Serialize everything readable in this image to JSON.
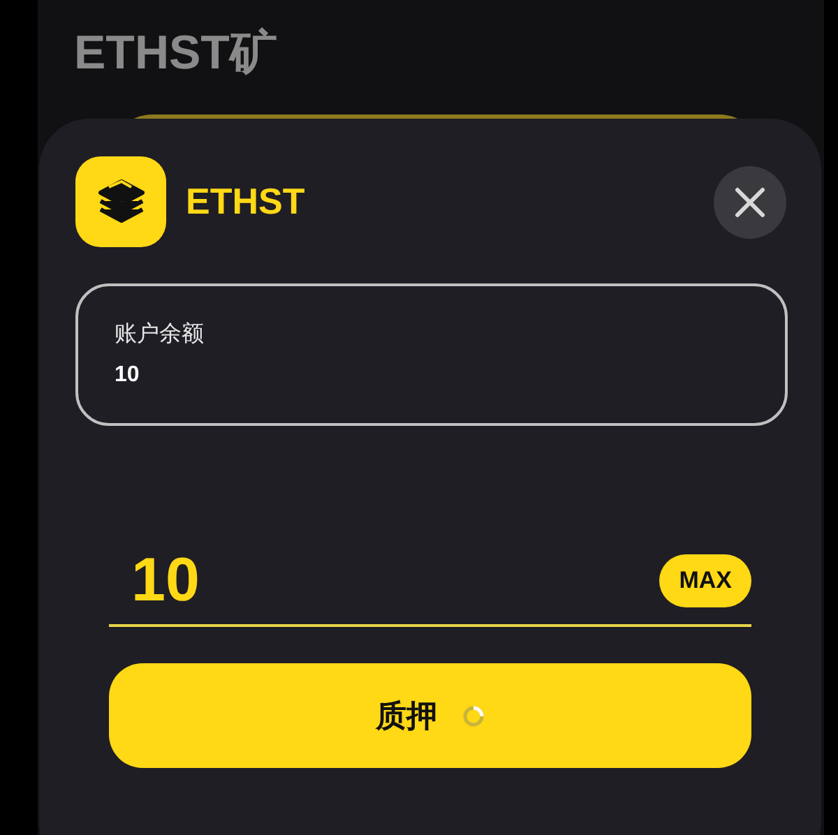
{
  "page": {
    "title": "ETHST矿"
  },
  "sheet": {
    "token": "ETHST",
    "balance": {
      "label": "账户余额",
      "value": "10"
    },
    "amount": {
      "value": "10"
    },
    "max_button": "MAX",
    "submit": {
      "label": "质押",
      "loading": true
    }
  }
}
